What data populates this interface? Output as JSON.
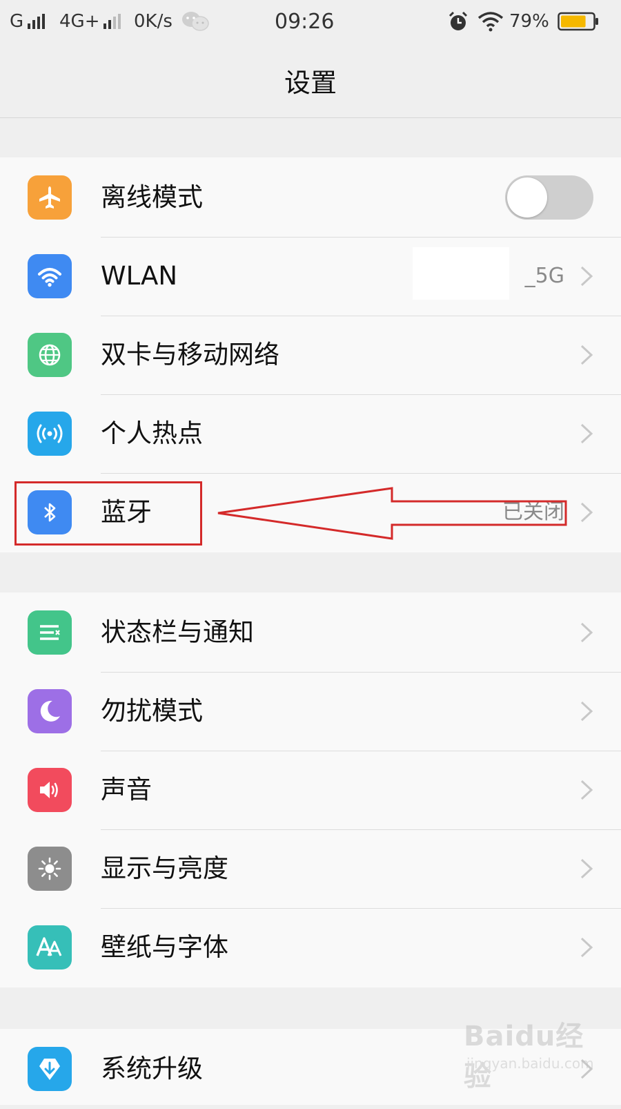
{
  "status_bar": {
    "carrier1": "G",
    "carrier2": "4G+",
    "speed": "0K/s",
    "time": "09:26",
    "battery": "79%",
    "battery_level": 0.79
  },
  "header": {
    "title": "设置"
  },
  "group1": [
    {
      "label": "离线模式",
      "icon": "airplane-icon",
      "color": "#f7a13a",
      "toggle_on": false
    },
    {
      "label": "WLAN",
      "icon": "wifi-icon",
      "color": "#3f8af2",
      "value": "_5G"
    },
    {
      "label": "双卡与移动网络",
      "icon": "globe-icon",
      "color": "#4fc784"
    },
    {
      "label": "个人热点",
      "icon": "hotspot-icon",
      "color": "#26a7ea"
    },
    {
      "label": "蓝牙",
      "icon": "bluetooth-icon",
      "color": "#3f8af2",
      "value": "已关闭"
    }
  ],
  "group2": [
    {
      "label": "状态栏与通知",
      "icon": "notification-icon",
      "color": "#43c58a"
    },
    {
      "label": "勿扰模式",
      "icon": "moon-icon",
      "color": "#9d6fe6"
    },
    {
      "label": "声音",
      "icon": "speaker-icon",
      "color": "#f24b5d"
    },
    {
      "label": "显示与亮度",
      "icon": "brightness-icon",
      "color": "#8d8d8d"
    },
    {
      "label": "壁纸与字体",
      "icon": "font-icon",
      "color": "#36bfb8"
    }
  ],
  "group3": [
    {
      "label": "系统升级",
      "icon": "system-update-icon",
      "color": "#26a7ea"
    }
  ],
  "annotation_color": "#d42a2a",
  "watermark": {
    "brand": "Baidu经验",
    "url": "jingyan.baidu.com"
  }
}
